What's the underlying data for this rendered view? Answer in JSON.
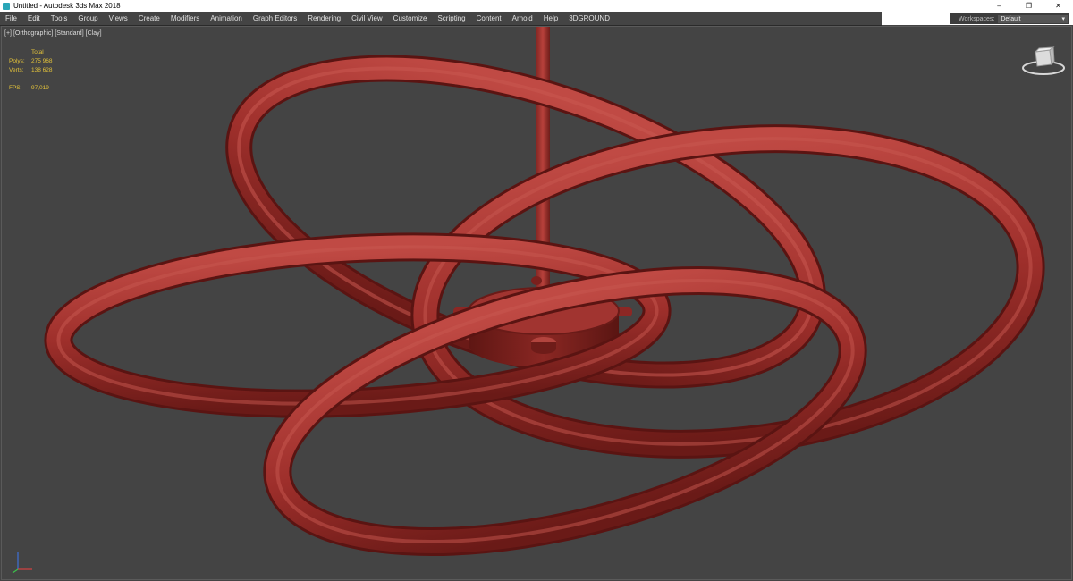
{
  "window": {
    "title": "Untitled - Autodesk 3ds Max 2018",
    "controls": [
      "–",
      "❐",
      "✕"
    ]
  },
  "menu": {
    "items": [
      "File",
      "Edit",
      "Tools",
      "Group",
      "Views",
      "Create",
      "Modifiers",
      "Animation",
      "Graph Editors",
      "Rendering",
      "Civil View",
      "Customize",
      "Scripting",
      "Content",
      "Arnold",
      "Help",
      "3DGROUND"
    ]
  },
  "workspaces": {
    "label": "Workspaces:",
    "value": "Default",
    "arrow": "▾"
  },
  "viewport": {
    "labels": [
      "[+]",
      "[Orthographic]",
      "[Standard]",
      "[Clay]"
    ],
    "stats": {
      "header": "Total",
      "polys_label": "Polys:",
      "polys_value": "275 968",
      "verts_label": "Verts:",
      "verts_value": "138 628",
      "fps_label": "FPS:",
      "fps_value": "97,019"
    }
  },
  "colors": {
    "ring": "#9e2f2b",
    "ring_highlight": "#c14a43",
    "ring_shadow": "#5c1412",
    "viewport_bg": "#444444"
  }
}
